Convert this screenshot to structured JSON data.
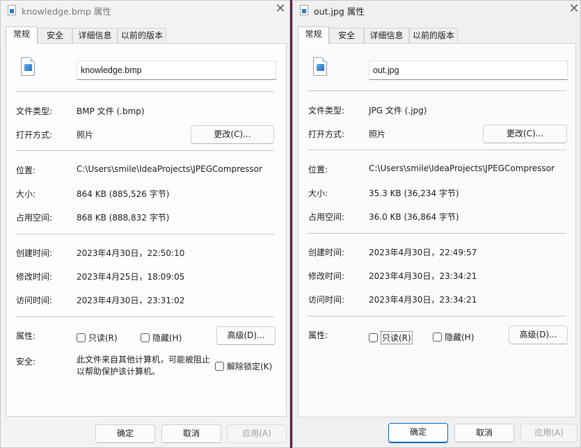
{
  "left_dialog": {
    "title": "knowledge.bmp 属性",
    "tabs": [
      "常规",
      "安全",
      "详细信息",
      "以前的版本"
    ],
    "file_name": "knowledge.bmp",
    "labels": {
      "type": "文件类型:",
      "opens_with": "打开方式:",
      "location": "位置:",
      "size": "大小:",
      "size_on_disk": "占用空间:",
      "created": "创建时间:",
      "modified": "修改时间:",
      "accessed": "访问时间:",
      "attributes": "属性:",
      "security": "安全:"
    },
    "values": {
      "type": "BMP 文件 (.bmp)",
      "opens_with": "照片",
      "location": "C:\\Users\\smile\\IdeaProjects\\JPEGCompressor",
      "size": "864 KB (885,526 字节)",
      "size_on_disk": "868 KB (888,832 字节)",
      "created": "2023年4月30日，22:50:10",
      "modified": "2023年4月25日，18:09:05",
      "accessed": "2023年4月30日，23:31:02",
      "security_text": "此文件来自其他计算机，可能被阻止以帮助保护该计算机。"
    },
    "buttons": {
      "change": "更改(C)...",
      "advanced": "高级(D)...",
      "ok": "确定",
      "cancel": "取消",
      "apply": "应用(A)"
    },
    "checkboxes": {
      "readonly": "只读(R)",
      "hidden": "隐藏(H)",
      "unblock": "解除锁定(K)"
    }
  },
  "right_dialog": {
    "title": "out.jpg 属性",
    "tabs": [
      "常规",
      "安全",
      "详细信息",
      "以前的版本"
    ],
    "file_name": "out.jpg",
    "labels": {
      "type": "文件类型:",
      "opens_with": "打开方式:",
      "location": "位置:",
      "size": "大小:",
      "size_on_disk": "占用空间:",
      "created": "创建时间:",
      "modified": "修改时间:",
      "accessed": "访问时间:",
      "attributes": "属性:"
    },
    "values": {
      "type": "JPG 文件 (.jpg)",
      "opens_with": "照片",
      "location": "C:\\Users\\smile\\IdeaProjects\\JPEGCompressor",
      "size": "35.3 KB (36,234 字节)",
      "size_on_disk": "36.0 KB (36,864 字节)",
      "created": "2023年4月30日，22:49:57",
      "modified": "2023年4月30日，23:34:21",
      "accessed": "2023年4月30日，23:34:21"
    },
    "buttons": {
      "change": "更改(C)...",
      "advanced": "高级(D)...",
      "ok": "确定",
      "cancel": "取消",
      "apply": "应用(A)"
    },
    "checkboxes": {
      "readonly": "只读(R)",
      "hidden": "隐藏(H)"
    }
  },
  "icons": {
    "close": "close-icon",
    "file": "image-file-icon"
  },
  "colors": {
    "accent": "#0067c0",
    "desktop": "#5a2448"
  }
}
